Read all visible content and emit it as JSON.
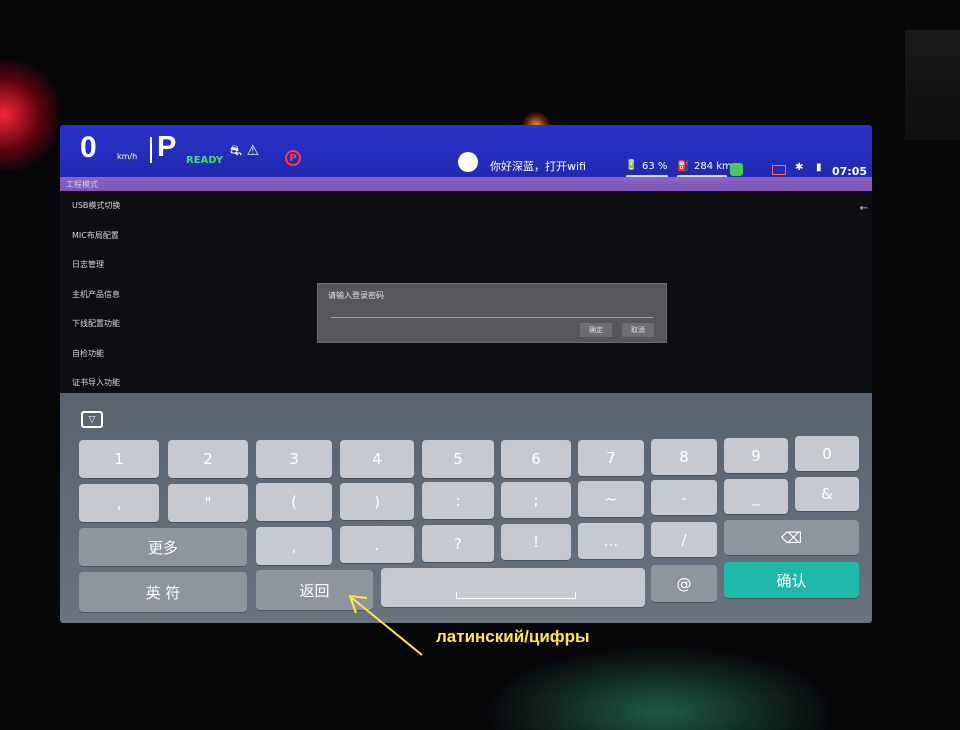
{
  "status": {
    "speed": "0",
    "speed_unit": "km/h",
    "gear": "P",
    "ready": "READY",
    "warning_icons": "⛐ ⚠",
    "brake": "P",
    "greeting": "你好深蓝，打开wifi",
    "battery": "63 %",
    "range": "284 km",
    "time": "07:05"
  },
  "subbar": {
    "title": "工程模式"
  },
  "menu": {
    "items": [
      {
        "label": "USB模式切换"
      },
      {
        "label": "MIC布局配置"
      },
      {
        "label": "日志管理"
      },
      {
        "label": "主机产品信息"
      },
      {
        "label": "下线配置功能"
      },
      {
        "label": "自检功能"
      },
      {
        "label": "证书导入功能"
      }
    ]
  },
  "dialog": {
    "title": "请输入登录密码",
    "input_value": "",
    "ok_label": "确定",
    "cancel_label": "取消"
  },
  "keyboard": {
    "row1": [
      "1",
      "2",
      "3",
      "4",
      "5",
      "6",
      "7",
      "8",
      "9",
      "0"
    ],
    "row2": [
      ",",
      "\"",
      "(",
      ")",
      ":",
      ";",
      "~",
      "-",
      "_",
      "&"
    ],
    "row3": [
      ",",
      ".",
      "?",
      "!",
      "...",
      "/"
    ],
    "more_label": "更多",
    "lang_label": "英 符",
    "back_label": "返回",
    "at_label": "@",
    "confirm_label": "确认",
    "delete_symbol": "⌫"
  },
  "annotation": {
    "text": "латинский/цифры"
  },
  "colors": {
    "status_bar": "#2a33c8",
    "sub_bar": "#8c63c6",
    "accent_teal": "#1fb9a9",
    "annotation": "#ffe64d"
  }
}
